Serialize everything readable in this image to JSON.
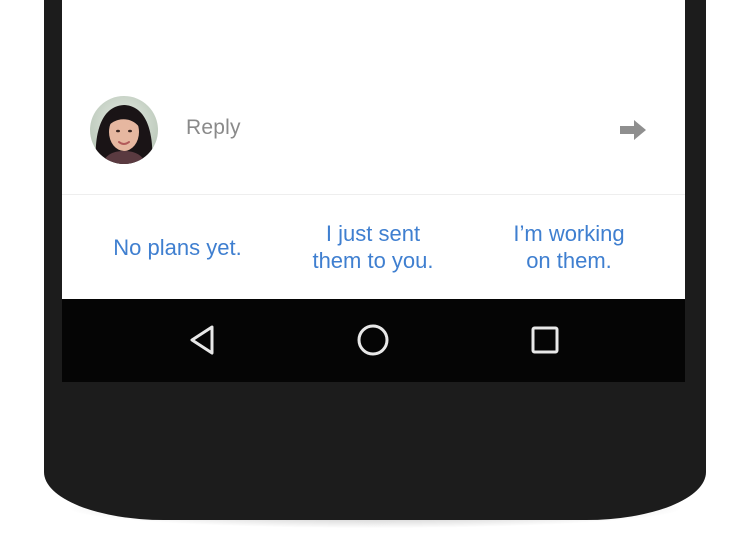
{
  "reply": {
    "placeholder": "Reply"
  },
  "smart_replies": [
    {
      "line1": "No plans yet.",
      "line2": ""
    },
    {
      "line1": "I just sent",
      "line2": "them to you."
    },
    {
      "line1": "I’m working",
      "line2": "on them."
    }
  ],
  "icons": {
    "send": "send-arrow-icon",
    "back": "back-triangle-icon",
    "home": "home-circle-icon",
    "recents": "recents-square-icon"
  },
  "colors": {
    "suggestion_text": "#3f7fd0",
    "reply_placeholder": "#8a8a8a",
    "nav_bar": "#050505",
    "phone_body": "#1c1c1c"
  }
}
